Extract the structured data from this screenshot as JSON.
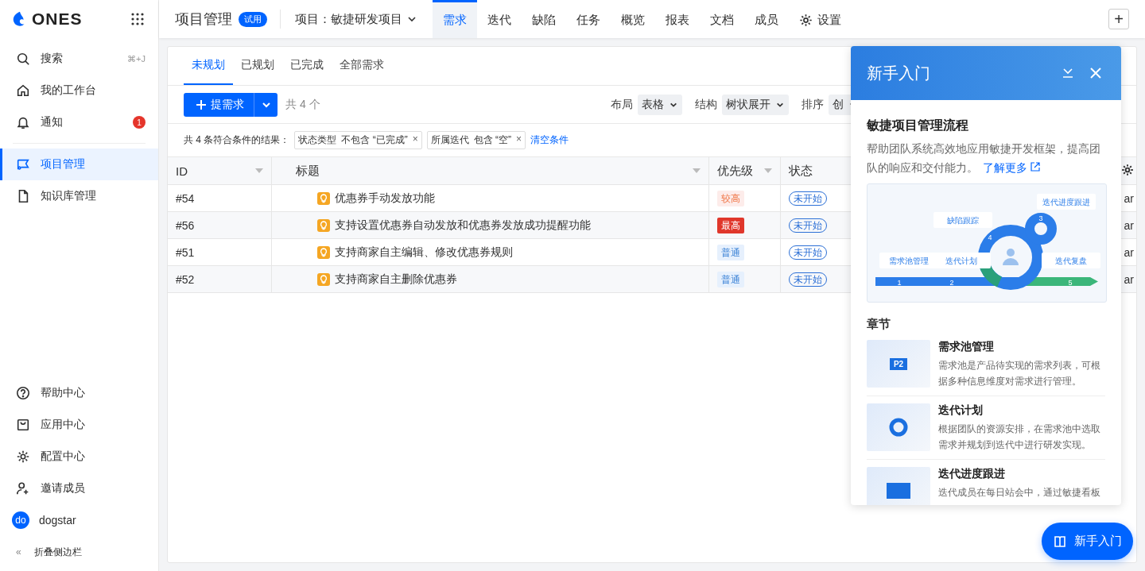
{
  "brand": {
    "logo_text": "ONES"
  },
  "sidebar": {
    "items": [
      {
        "label": "搜索",
        "shortcut": "⌘+J",
        "selected": false
      },
      {
        "label": "我的工作台",
        "selected": false
      },
      {
        "label": "通知",
        "badge": "1",
        "selected": false
      },
      {
        "label": "项目管理",
        "selected": true
      },
      {
        "label": "知识库管理",
        "selected": false
      }
    ],
    "bottom_items": [
      {
        "label": "帮助中心"
      },
      {
        "label": "应用中心"
      },
      {
        "label": "配置中心"
      },
      {
        "label": "邀请成员"
      }
    ],
    "user": {
      "avatar": "do",
      "name": "dogstar"
    },
    "collapse": {
      "icon_text": "«",
      "label": "折叠侧边栏"
    }
  },
  "topbar": {
    "title": "项目管理",
    "tag": "试用",
    "project": "项目：敏捷研发项目",
    "tabs": [
      {
        "label": "需求",
        "selected": true
      },
      {
        "label": "迭代",
        "selected": false
      },
      {
        "label": "缺陷",
        "selected": false
      },
      {
        "label": "任务",
        "selected": false
      },
      {
        "label": "概览",
        "selected": false
      },
      {
        "label": "报表",
        "selected": false
      },
      {
        "label": "文档",
        "selected": false
      },
      {
        "label": "成员",
        "selected": false
      },
      {
        "label": "设置",
        "selected": false
      }
    ],
    "add_button": "+"
  },
  "subtabs": [
    {
      "label": "未规划",
      "selected": true
    },
    {
      "label": "已规划",
      "selected": false
    },
    {
      "label": "已完成",
      "selected": false
    },
    {
      "label": "全部需求",
      "selected": false
    }
  ],
  "toolbar": {
    "create_button": "提需求",
    "count": "共 4 个",
    "controls": [
      {
        "label": "布局",
        "value": "表格"
      },
      {
        "label": "结构",
        "value": "树状展开"
      },
      {
        "label": "排序",
        "value": "创"
      }
    ]
  },
  "filter": {
    "summary": "共 4 条符合条件的结果：",
    "chips": [
      {
        "field": "状态类型",
        "text": "不包含 “已完成”",
        "remove": "×"
      },
      {
        "field": "所属迭代",
        "text": "包含 “空”",
        "remove": "×"
      }
    ],
    "clear": "清空条件"
  },
  "table": {
    "columns": [
      {
        "label": "ID",
        "sortable": true
      },
      {
        "label": "标题",
        "sortable": true
      },
      {
        "label": "优先级",
        "sortable": true
      },
      {
        "label": "状态",
        "sortable": false
      }
    ],
    "rows": [
      {
        "id": "#54",
        "title": "优惠券手动发放功能",
        "priority": {
          "label": "较高",
          "kind": "high"
        },
        "status": "未开始",
        "column_5": "ar"
      },
      {
        "id": "#56",
        "title": "支持设置优惠券自动发放和优惠券发放成功提醒功能",
        "priority": {
          "label": "最高",
          "kind": "highest"
        },
        "status": "未开始",
        "column_5": "ar"
      },
      {
        "id": "#51",
        "title": "支持商家自主编辑、修改优惠券规则",
        "priority": {
          "label": "普通",
          "kind": "normal"
        },
        "status": "未开始",
        "column_5": "ar"
      },
      {
        "id": "#52",
        "title": "支持商家自主删除优惠券",
        "priority": {
          "label": "普通",
          "kind": "normal"
        },
        "status": "未开始",
        "column_5": "ar"
      }
    ]
  },
  "guide_panel": {
    "title": "新手入门",
    "heading": "敏捷项目管理流程",
    "description": "帮助团队系统高效地应用敏捷开发框架，提高团队的响应和交付能力。",
    "link": "了解更多",
    "diagram": {
      "labels": [
        "需求池管理",
        "迭代计划",
        "缺陷跟踪",
        "迭代进度跟进",
        "迭代复盘"
      ],
      "steps": [
        "1",
        "2",
        "3",
        "4",
        "5"
      ]
    },
    "chapters_heading": "章节",
    "chapters": [
      {
        "title": "需求池管理",
        "description": "需求池是产品待实现的需求列表，可根据多种信息维度对需求进行管理。",
        "thumb_text": "P2"
      },
      {
        "title": "迭代计划",
        "description": "根据团队的资源安排，在需求池中选取需求并规划到迭代中进行研发实现。"
      },
      {
        "title": "迭代进度跟进",
        "description": "迭代成员在每日站会中，通过敏捷看板"
      }
    ]
  },
  "guide_button": {
    "label": "新手入门"
  }
}
